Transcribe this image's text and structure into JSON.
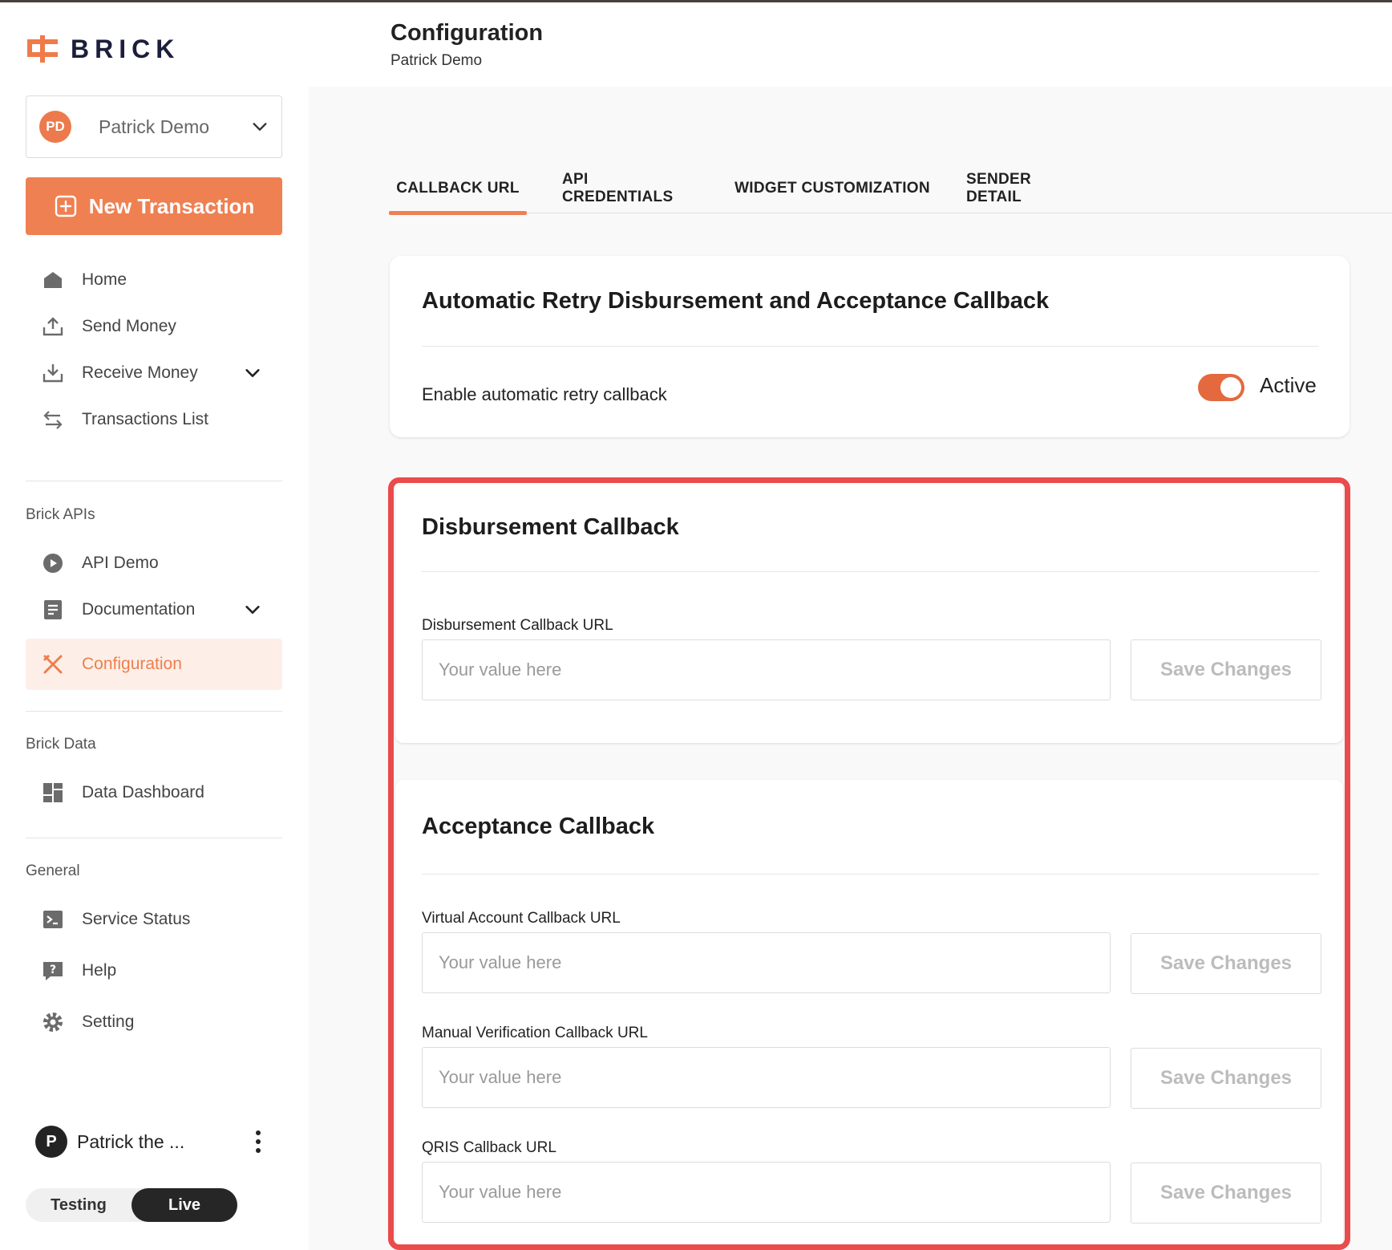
{
  "brand": {
    "name": "BRICK",
    "accent": "#ef8052"
  },
  "account": {
    "initials": "PD",
    "name": "Patrick Demo"
  },
  "new_transaction_label": "New Transaction",
  "nav": {
    "home": "Home",
    "send_money": "Send Money",
    "receive_money": "Receive Money",
    "transactions_list": "Transactions List",
    "section_apis": "Brick APIs",
    "api_demo": "API Demo",
    "documentation": "Documentation",
    "configuration": "Configuration",
    "section_data": "Brick Data",
    "data_dashboard": "Data Dashboard",
    "section_general": "General",
    "service_status": "Service Status",
    "help": "Help",
    "setting": "Setting"
  },
  "user": {
    "initial": "P",
    "name": "Patrick the ..."
  },
  "environment": {
    "testing": "Testing",
    "live": "Live",
    "selected": "Live"
  },
  "header": {
    "title": "Configuration",
    "subtitle": "Patrick Demo"
  },
  "tabs": [
    {
      "label": "CALLBACK URL",
      "active": true
    },
    {
      "label": "API CREDENTIALS",
      "active": false
    },
    {
      "label": "WIDGET CUSTOMIZATION",
      "active": false
    },
    {
      "label": "SENDER DETAIL",
      "active": false
    }
  ],
  "retry": {
    "title": "Automatic Retry Disbursement and Acceptance Callback",
    "label": "Enable automatic retry callback",
    "state": "Active",
    "enabled": true
  },
  "disbursement": {
    "title": "Disbursement Callback",
    "field_label": "Disbursement Callback URL",
    "placeholder": "Your value here",
    "save_label": "Save Changes"
  },
  "acceptance": {
    "title": "Acceptance Callback",
    "fields": [
      {
        "label": "Virtual Account Callback URL",
        "placeholder": "Your value here",
        "save_label": "Save Changes"
      },
      {
        "label": "Manual Verification Callback URL",
        "placeholder": "Your value here",
        "save_label": "Save Changes"
      },
      {
        "label": "QRIS Callback URL",
        "placeholder": "Your value here",
        "save_label": "Save Changes"
      }
    ]
  }
}
